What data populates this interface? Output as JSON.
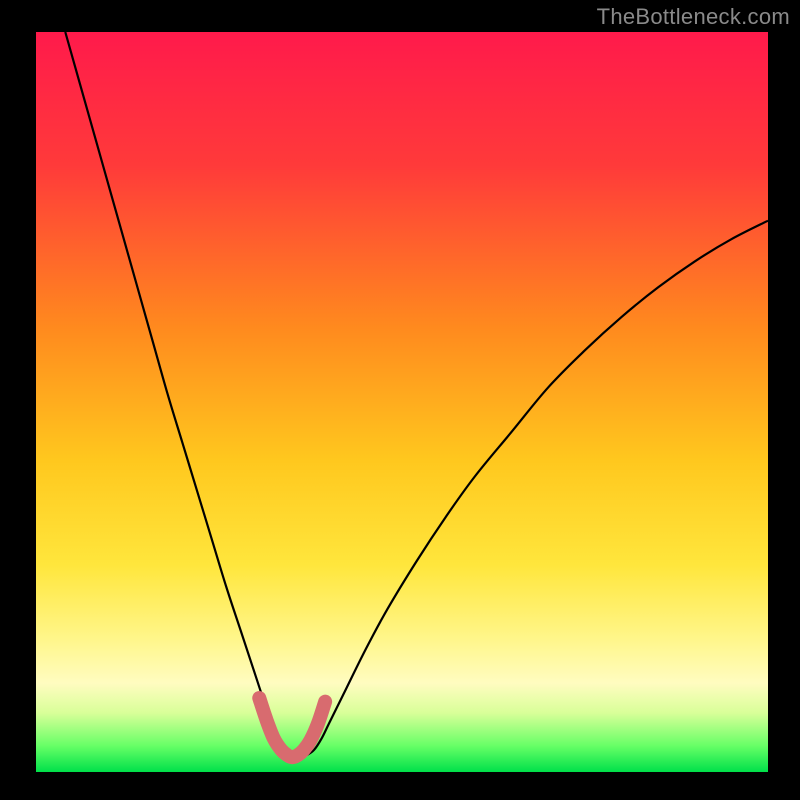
{
  "watermark": "TheBottleneck.com",
  "chart_data": {
    "type": "line",
    "title": "",
    "xlabel": "",
    "ylabel": "",
    "xlim": [
      0,
      100
    ],
    "ylim": [
      0,
      100
    ],
    "grid": false,
    "legend": false,
    "background_gradient": {
      "stops": [
        {
          "offset": 0.0,
          "color": "#ff1a4b"
        },
        {
          "offset": 0.18,
          "color": "#ff3a3a"
        },
        {
          "offset": 0.4,
          "color": "#ff8a1e"
        },
        {
          "offset": 0.58,
          "color": "#ffc81e"
        },
        {
          "offset": 0.72,
          "color": "#ffe63c"
        },
        {
          "offset": 0.82,
          "color": "#fff68a"
        },
        {
          "offset": 0.88,
          "color": "#fffcc0"
        },
        {
          "offset": 0.92,
          "color": "#d9ff99"
        },
        {
          "offset": 0.965,
          "color": "#66ff66"
        },
        {
          "offset": 1.0,
          "color": "#00e04a"
        }
      ]
    },
    "series": [
      {
        "name": "bottleneck-curve",
        "stroke": "#000000",
        "stroke_width": 2.2,
        "x": [
          4,
          6,
          8,
          10,
          12,
          14,
          16,
          18,
          20,
          22,
          24,
          26,
          28,
          30,
          31,
          32,
          33,
          34,
          34.5,
          35,
          36,
          37,
          38,
          39,
          40,
          42,
          45,
          48,
          52,
          56,
          60,
          65,
          70,
          75,
          80,
          85,
          90,
          95,
          100
        ],
        "y": [
          100,
          93,
          86,
          79,
          72,
          65,
          58,
          51,
          44.5,
          38,
          31.5,
          25,
          19,
          13,
          10,
          7.2,
          4.8,
          3.0,
          2.3,
          2.0,
          2.0,
          2.3,
          3.0,
          4.5,
          6.5,
          10.5,
          16.5,
          22,
          28.5,
          34.5,
          40,
          46,
          52,
          57,
          61.5,
          65.5,
          69,
          72,
          74.5
        ]
      },
      {
        "name": "bottom-highlight",
        "stroke": "#d86b6f",
        "stroke_width": 14,
        "linecap": "round",
        "x": [
          30.5,
          31.5,
          32.5,
          33.5,
          34.3,
          35.0,
          35.8,
          36.6,
          37.5,
          38.5,
          39.5
        ],
        "y": [
          10.0,
          7.0,
          4.5,
          3.0,
          2.3,
          2.0,
          2.3,
          3.0,
          4.3,
          6.5,
          9.5
        ]
      }
    ]
  }
}
